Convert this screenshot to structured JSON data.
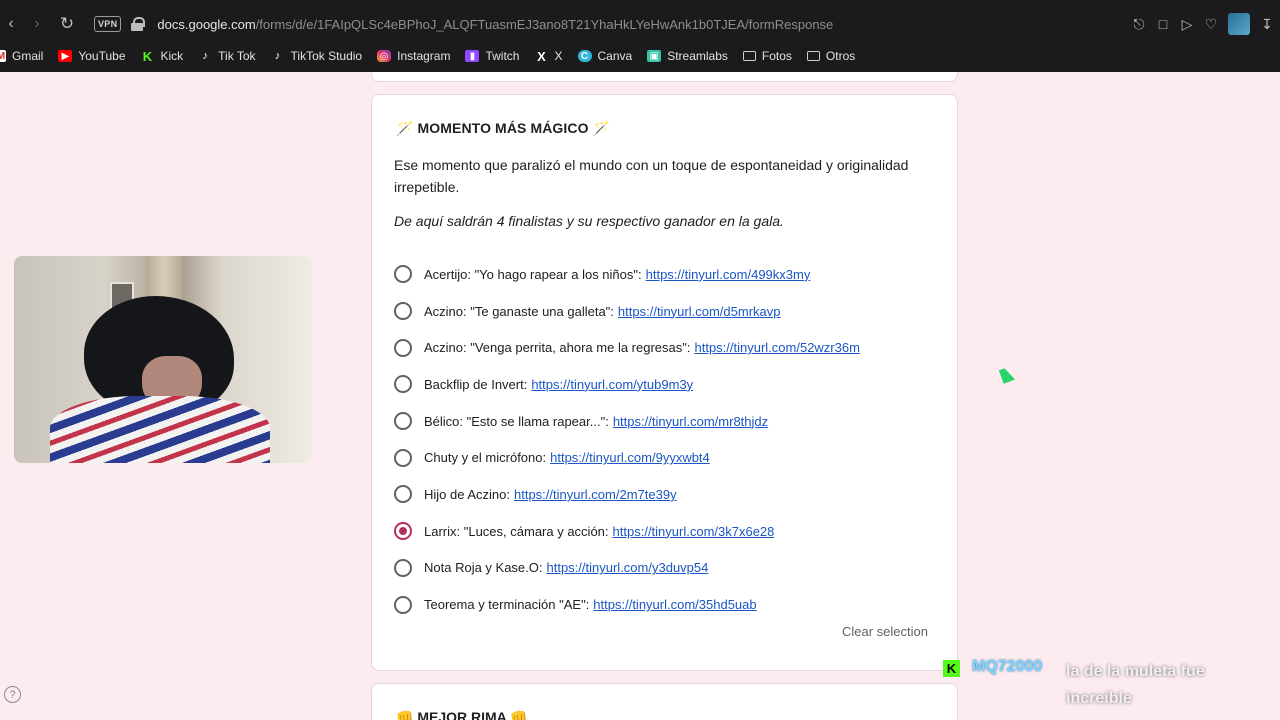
{
  "browser": {
    "url_host": "docs.google.com",
    "url_path": "/forms/d/e/1FAIpQLSc4eBPhoJ_ALQFTuasmEJ3ano8T21YhaHkLYeHwAnk1b0TJEA/formResponse",
    "vpn_label": "VPN"
  },
  "bookmarks": [
    {
      "label": "Gmail",
      "icon": "gmail-icon"
    },
    {
      "label": "YouTube",
      "icon": "youtube-icon"
    },
    {
      "label": "Kick",
      "icon": "kick-icon"
    },
    {
      "label": "Tik Tok",
      "icon": "tiktok-icon"
    },
    {
      "label": "TikTok Studio",
      "icon": "tiktok-icon"
    },
    {
      "label": "Instagram",
      "icon": "instagram-icon"
    },
    {
      "label": "Twitch",
      "icon": "twitch-icon"
    },
    {
      "label": "X",
      "icon": "x-icon"
    },
    {
      "label": "Canva",
      "icon": "canva-icon"
    },
    {
      "label": "Streamlabs",
      "icon": "streamlabs-icon"
    },
    {
      "label": "Fotos",
      "icon": "folder-icon"
    },
    {
      "label": "Otros",
      "icon": "folder-icon"
    }
  ],
  "question": {
    "title": "🪄 MOMENTO MÁS MÁGICO 🪄",
    "description": "Ese momento que paralizó el mundo con un toque de espontaneidad y originalidad irrepetible.",
    "note": "De aquí saldrán 4 finalistas y su respectivo ganador en la gala.",
    "options": [
      {
        "text": "Acertijo: \"Yo hago rapear a los niños\":",
        "link": "https://tinyurl.com/499kx3my",
        "selected": false
      },
      {
        "text": "Aczino: \"Te ganaste una galleta\":",
        "link": "https://tinyurl.com/d5mrkavp",
        "selected": false
      },
      {
        "text": "Aczino: \"Venga perrita, ahora me la regresas\":",
        "link": "https://tinyurl.com/52wzr36m",
        "selected": false
      },
      {
        "text": "Backflip de Invert:",
        "link": "https://tinyurl.com/ytub9m3y",
        "selected": false
      },
      {
        "text": "Bélico: \"Esto se llama rapear...\":",
        "link": "https://tinyurl.com/mr8thjdz",
        "selected": false
      },
      {
        "text": "Chuty y el micrófono:",
        "link": "https://tinyurl.com/9yyxwbt4",
        "selected": false
      },
      {
        "text": "Hijo de Aczino:",
        "link": "https://tinyurl.com/2m7te39y",
        "selected": false
      },
      {
        "text": "Larrix: \"Luces, cámara y acción:",
        "link": "https://tinyurl.com/3k7x6e28",
        "selected": true
      },
      {
        "text": "Nota Roja y Kase.O:",
        "link": "https://tinyurl.com/y3duvp54",
        "selected": false
      },
      {
        "text": "Teorema y terminación \"AE\":",
        "link": "https://tinyurl.com/35hd5uab",
        "selected": false
      }
    ],
    "clear_label": "Clear selection"
  },
  "next_question": {
    "title": "👊 MEJOR RIMA 👊"
  },
  "chat": {
    "username": "MQ72000",
    "message": "la de la muleta fue increible"
  },
  "colors": {
    "page_bg": "#fcebef",
    "accent_radio": "#b1335a",
    "link": "#1a56c4"
  }
}
